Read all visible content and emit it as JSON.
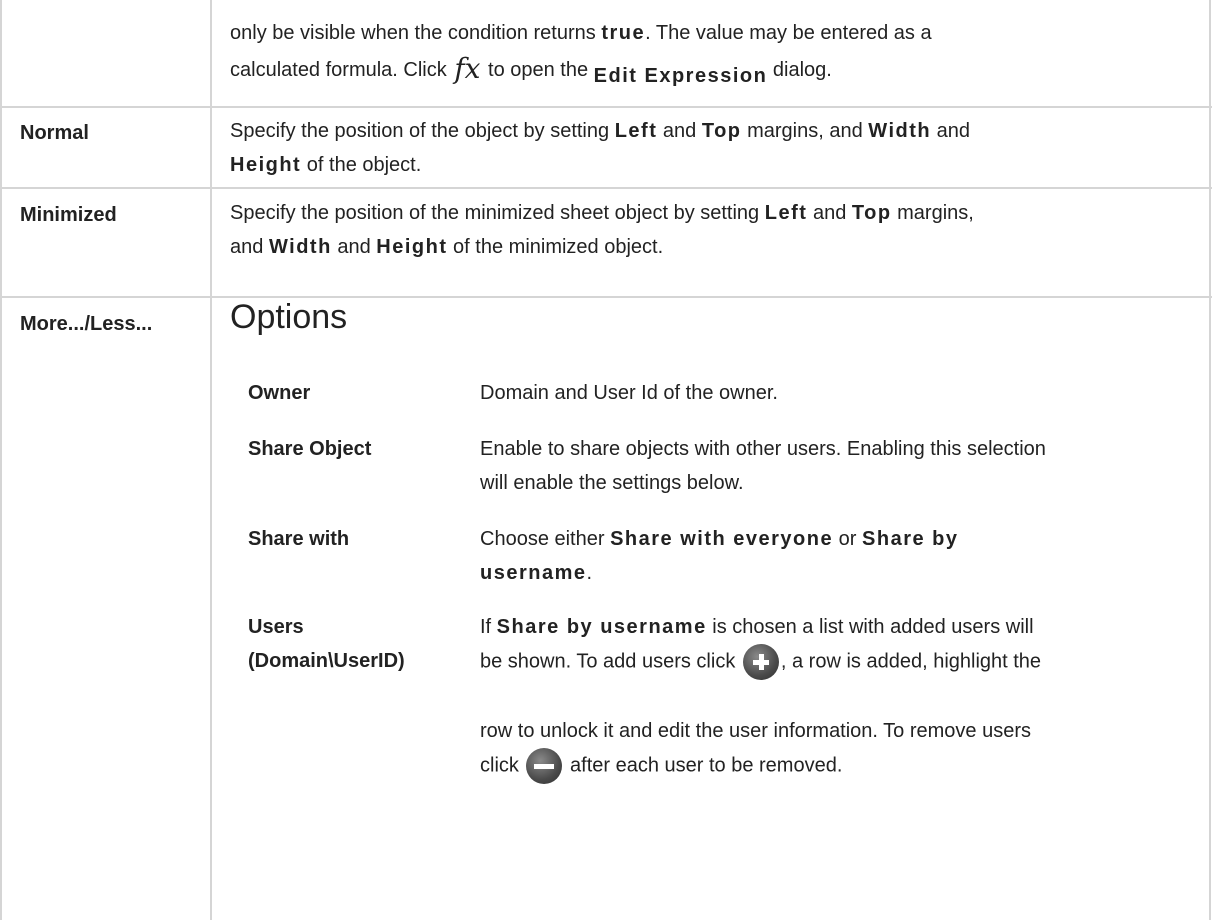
{
  "rows": {
    "r0": {
      "line1_a": "only be visible when the condition returns ",
      "line1_kw": "true",
      "line1_b": ". The value may be entered as a",
      "line2_a": "calculated formula. Click ",
      "fx": "fx",
      "line2_b": " to open the ",
      "edit_kw": "Edit Expression",
      "line2_c": " dialog."
    },
    "normal": {
      "term": "Normal",
      "a": "Specify the position of the object by setting ",
      "left": "Left",
      "b": " and ",
      "top": "Top",
      "c": " margins, and ",
      "width": "Width",
      "d": " and",
      "height": "Height",
      "e": " of the object."
    },
    "minimized": {
      "term": "Minimized",
      "a": "Specify the position of the minimized sheet object by setting ",
      "left": "Left",
      "b": " and ",
      "top": "Top",
      "c": " margins,",
      "d": "and ",
      "width": "Width",
      "e": " and ",
      "height": "Height",
      "f": " of the minimized object."
    },
    "more": {
      "term": "More.../Less...",
      "heading": "Options"
    }
  },
  "options": {
    "owner": {
      "term": "Owner",
      "desc": "Domain and User Id of the owner."
    },
    "share_object": {
      "term": "Share Object",
      "desc_l1": "Enable to share objects with other users. Enabling this selection",
      "desc_l2": "will enable the settings below."
    },
    "share_with": {
      "term": "Share with",
      "a": "Choose either ",
      "kw1": "Share with everyone",
      "b": " or ",
      "kw2a": "Share by",
      "kw2b": "username",
      "c": "."
    },
    "users": {
      "term_l1": "Users",
      "term_l2": "(Domain\\UserID)",
      "a": "If ",
      "kw": "Share by username",
      "b": " is chosen a list with added users will",
      "c": "be shown. To add users click ",
      "d": ", a row is added, highlight the",
      "e": "row to unlock it and edit the user information. To remove users",
      "f": "click ",
      "g": " after each user to be removed.",
      "add_icon": "plus-circle-icon",
      "remove_icon": "minus-circle-icon"
    }
  }
}
